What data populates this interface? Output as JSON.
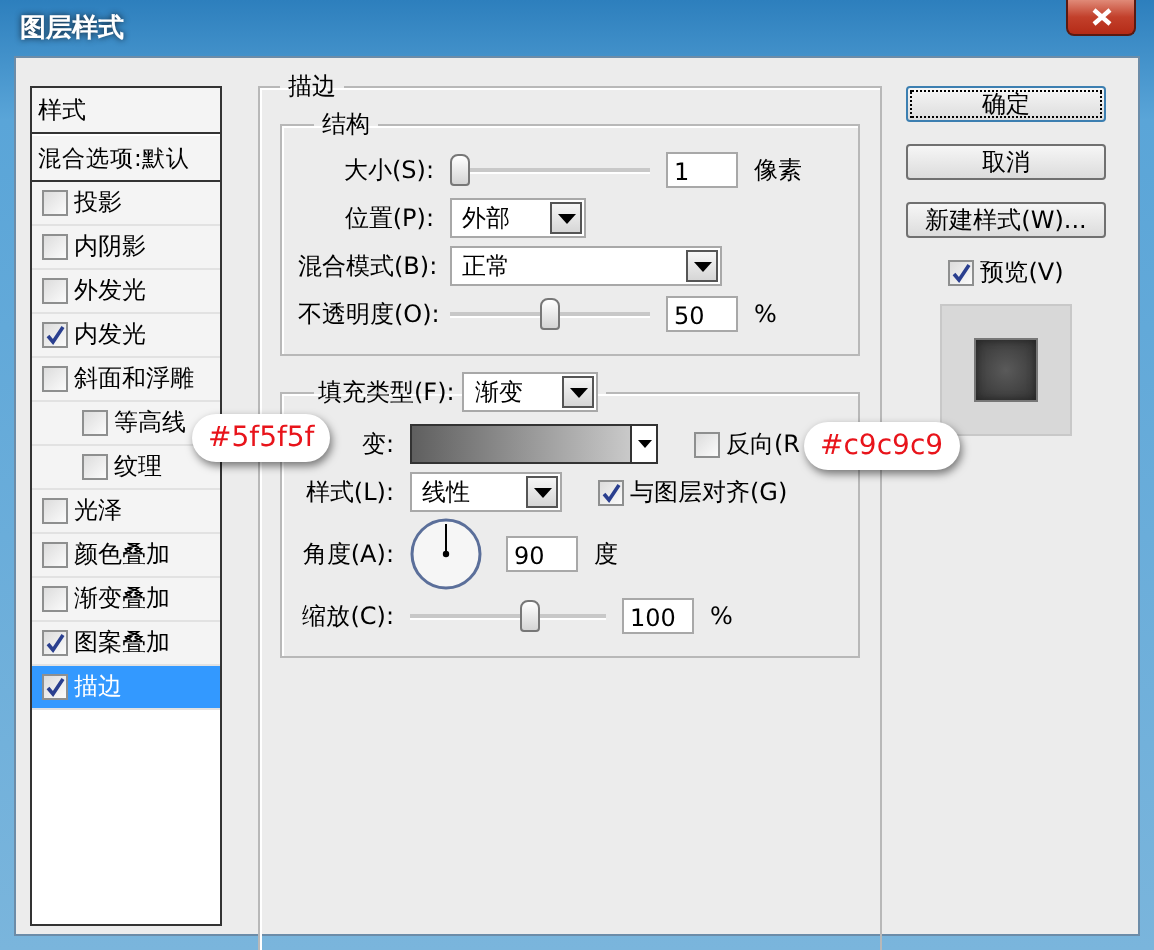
{
  "window": {
    "title": "图层样式"
  },
  "styles_panel": {
    "header": "样式",
    "blend_options": "混合选项:默认",
    "items": [
      {
        "label": "投影",
        "checked": false,
        "selected": false
      },
      {
        "label": "内阴影",
        "checked": false,
        "selected": false
      },
      {
        "label": "外发光",
        "checked": false,
        "selected": false
      },
      {
        "label": "内发光",
        "checked": true,
        "selected": false
      },
      {
        "label": "斜面和浮雕",
        "checked": false,
        "selected": false,
        "children": [
          {
            "label": "等高线",
            "checked": false,
            "selected": false
          },
          {
            "label": "纹理",
            "checked": false,
            "selected": false
          }
        ]
      },
      {
        "label": "光泽",
        "checked": false,
        "selected": false
      },
      {
        "label": "颜色叠加",
        "checked": false,
        "selected": false
      },
      {
        "label": "渐变叠加",
        "checked": false,
        "selected": false
      },
      {
        "label": "图案叠加",
        "checked": true,
        "selected": false
      },
      {
        "label": "描边",
        "checked": true,
        "selected": true
      }
    ]
  },
  "stroke": {
    "title": "描边",
    "structure": {
      "title": "结构",
      "size": {
        "label": "大小(S):",
        "level": 0,
        "value": "1",
        "unit": "像素"
      },
      "position": {
        "label": "位置(P):",
        "value": "外部"
      },
      "blend_mode": {
        "label": "混合模式(B):",
        "value": "正常"
      },
      "opacity": {
        "label": "不透明度(O):",
        "level": 0.5,
        "value": "50",
        "unit": "%"
      }
    },
    "fill": {
      "label": "填充类型(F):",
      "value": "渐变",
      "gradient": {
        "label": "变:"
      },
      "reverse": {
        "label": "反向(R",
        "checked": false
      },
      "style": {
        "label": "样式(L):",
        "value": "线性"
      },
      "align": {
        "label": "与图层对齐(G)",
        "checked": true
      },
      "angle": {
        "label": "角度(A):",
        "value": "90",
        "unit": "度"
      },
      "scale": {
        "label": "缩放(C):",
        "level": 0.62,
        "value": "100",
        "unit": "%"
      }
    }
  },
  "buttons": [
    {
      "label": "确定",
      "default": true
    },
    {
      "label": "取消",
      "default": false
    },
    {
      "label": "新建样式(W)...",
      "default": false
    }
  ],
  "preview": {
    "label": "预览(V)",
    "checked": true
  },
  "annotations": [
    {
      "text": "#5f5f5f"
    },
    {
      "text": "#c9c9c9"
    }
  ]
}
